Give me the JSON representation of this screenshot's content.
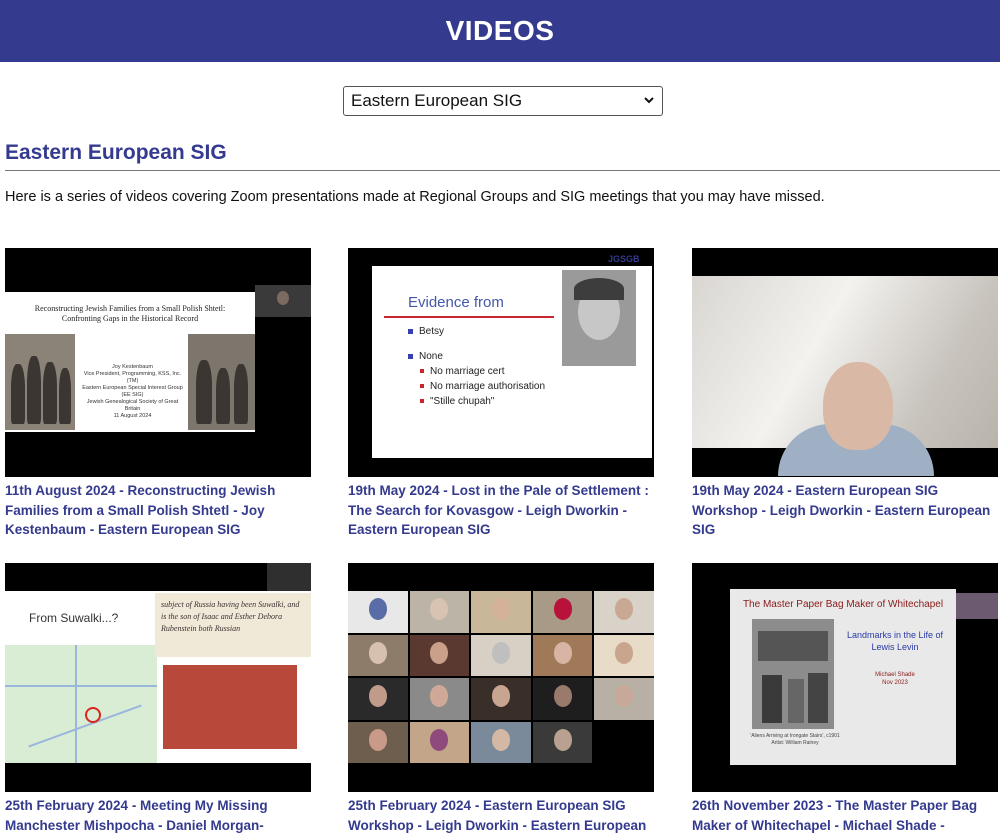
{
  "header": {
    "title": "VIDEOS"
  },
  "filter": {
    "selected": "Eastern European SIG"
  },
  "section": {
    "title": "Eastern European SIG",
    "intro": "Here is a series of videos covering Zoom presentations made at Regional Groups and SIG meetings that you may have missed."
  },
  "videos": [
    {
      "caption": "11th August 2024 - Reconstructing Jewish Families from a Small Polish Shtetl - Joy Kestenbaum - Eastern European SIG",
      "slide_title": "Reconstructing Jewish Families from a Small Polish Shtetl: Confronting Gaps in the Historical Record",
      "slide_info": "Joy Kestenbaum\nVice President, Programming, KSS, Inc. (TM)\nEastern European Special Interest Group (EE SIG)\nJewish Genealogical Society of Great Britain\n11 August 2024"
    },
    {
      "caption": "19th May 2024 - Lost in the Pale of Settlement : The Search for Kovasgow - Leigh Dworkin - Eastern European SIG",
      "slide_heading": "Evidence from",
      "slide_items": [
        "Betsy",
        "None"
      ],
      "slide_subitems": [
        "No marriage cert",
        "No marriage authorisation",
        "\"Stille chupah\""
      ],
      "logo_text": "JGSGB"
    },
    {
      "caption": "19th May 2024 - Eastern European SIG Workshop - Leigh Dworkin - Eastern European SIG"
    },
    {
      "caption": "25th February 2024 - Meeting My Missing Manchester Mishpocha - Daniel Morgan-",
      "slide_text": "From Suwalki...?",
      "handwriting": "subject of Russia having been Suwalki, and is the son of Isaac and Esther Debora Rubenstein both Russian"
    },
    {
      "caption": "25th February 2024 - Eastern European SIG Workshop - Leigh Dworkin - Eastern European"
    },
    {
      "caption": "26th November 2023 - The Master Paper Bag Maker of Whitechapel - Michael Shade - Eastern",
      "slide_title": "The Master Paper Bag Maker of Whitechapel",
      "slide_subtitle": "Landmarks in the Life of Lewis Levin",
      "slide_author": "Michael Shade\nNov 2023",
      "slide_credit": "'Aliens Arriving at Irongate Stairs', c1901\nArtist: William Rainey"
    }
  ],
  "colors": {
    "header_bg": "#343a8e",
    "link": "#343a8e",
    "accent_red": "#c8252d"
  }
}
